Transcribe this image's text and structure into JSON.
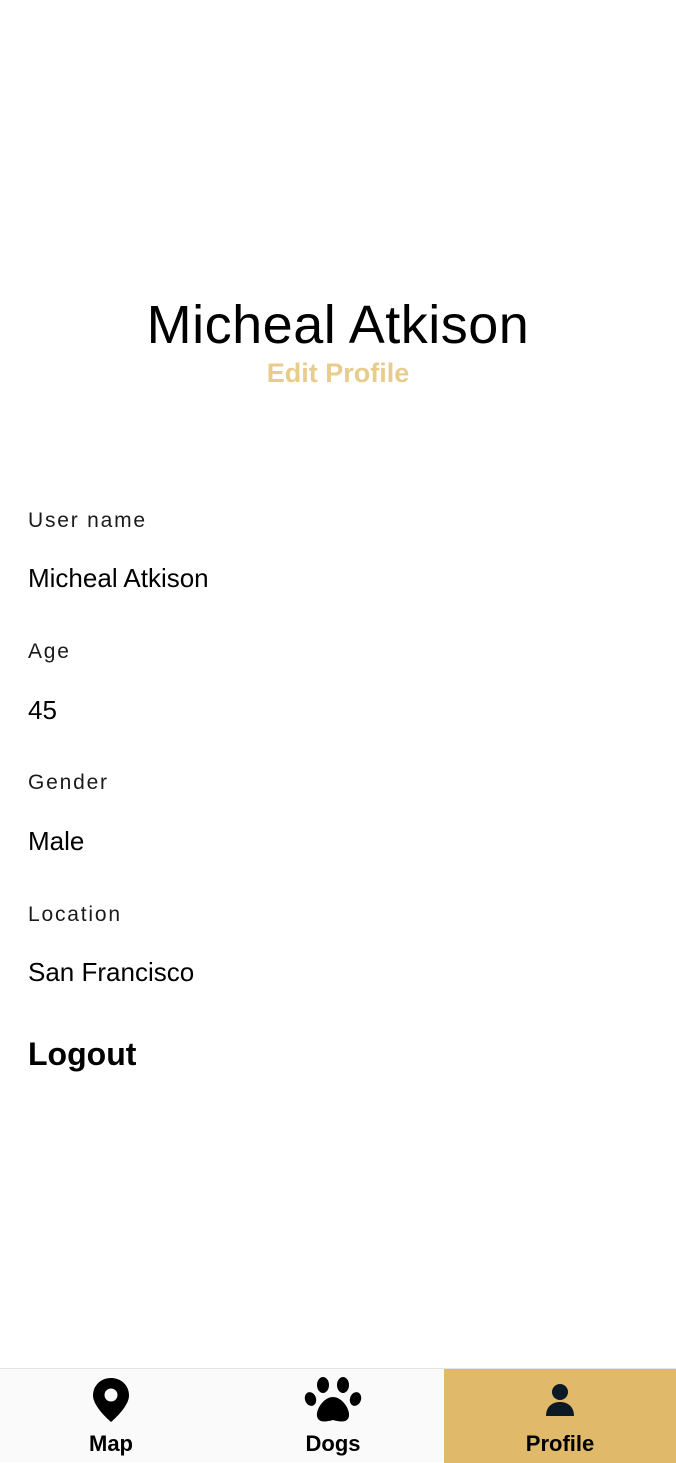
{
  "header": {
    "name": "Micheal Atkison",
    "edit_label": "Edit Profile"
  },
  "fields": [
    {
      "label": "User name",
      "value": "Micheal Atkison"
    },
    {
      "label": "Age",
      "value": "45"
    },
    {
      "label": "Gender",
      "value": "Male"
    },
    {
      "label": "Location",
      "value": "San Francisco"
    }
  ],
  "logout_label": "Logout",
  "tabs": [
    {
      "label": "Map",
      "icon": "map-pin-icon",
      "active": false
    },
    {
      "label": "Dogs",
      "icon": "paw-icon",
      "active": false
    },
    {
      "label": "Profile",
      "icon": "person-icon",
      "active": true
    }
  ],
  "colors": {
    "accent": "#e0b96b",
    "edit_link": "#e8cc8c",
    "text": "#000000",
    "tabbar_bg": "#fafafa"
  }
}
